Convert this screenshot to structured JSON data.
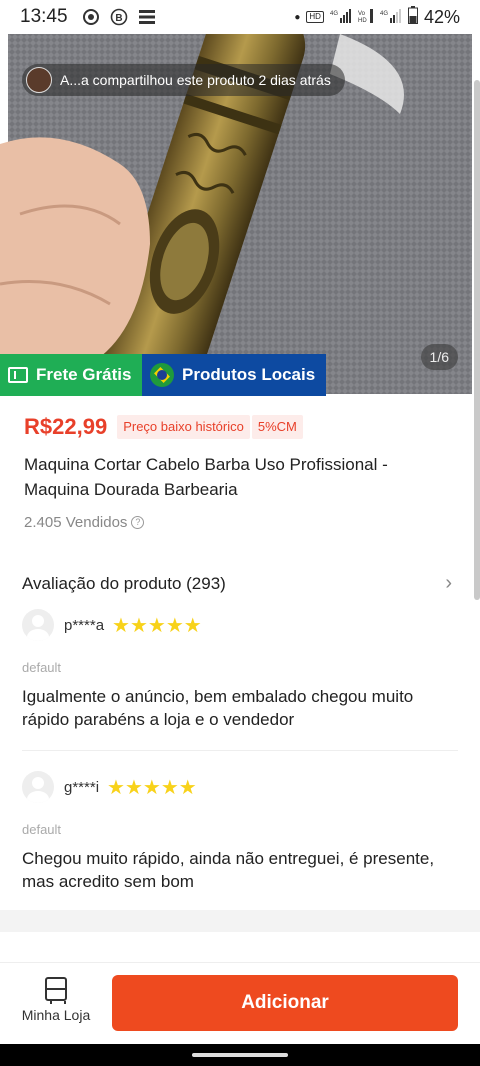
{
  "status_bar": {
    "time": "13:45",
    "battery": "42%",
    "net_badges": [
      "HD",
      "4G",
      "Vo LTE",
      "4G"
    ]
  },
  "hero": {
    "share_text": "A...a compartilhou este produto 2 dias atrás",
    "image_counter": "1/6",
    "badge_free": "Frete Grátis",
    "badge_local": "Produtos Locais"
  },
  "product": {
    "price": "R$22,99",
    "price_tag": "Preço baixo histórico",
    "price_pct": "5%CM",
    "title": "Maquina Cortar Cabelo Barba Uso Profissional - Maquina Dourada Barbearia",
    "sold": "2.405 Vendidos"
  },
  "reviews": {
    "header": "Avaliação do produto (293)",
    "items": [
      {
        "user": "p****a",
        "stars": "★★★★★",
        "variant": "default",
        "text": "Igualmente o anúncio, bem embalado chegou muito rápido parabéns a loja e o vendedor"
      },
      {
        "user": "g****i",
        "stars": "★★★★★",
        "variant": "default",
        "text": "Chegou muito rápido, ainda não entreguei, é presente, mas acredito sem bom"
      }
    ]
  },
  "bottom_bar": {
    "store_label": "Minha Loja",
    "add_label": "Adicionar"
  },
  "colors": {
    "accent": "#ee4a1f",
    "price": "#e8402a",
    "free_shipping": "#1fae55",
    "local_products": "#0d4aa1",
    "stars": "#f8d21a"
  }
}
